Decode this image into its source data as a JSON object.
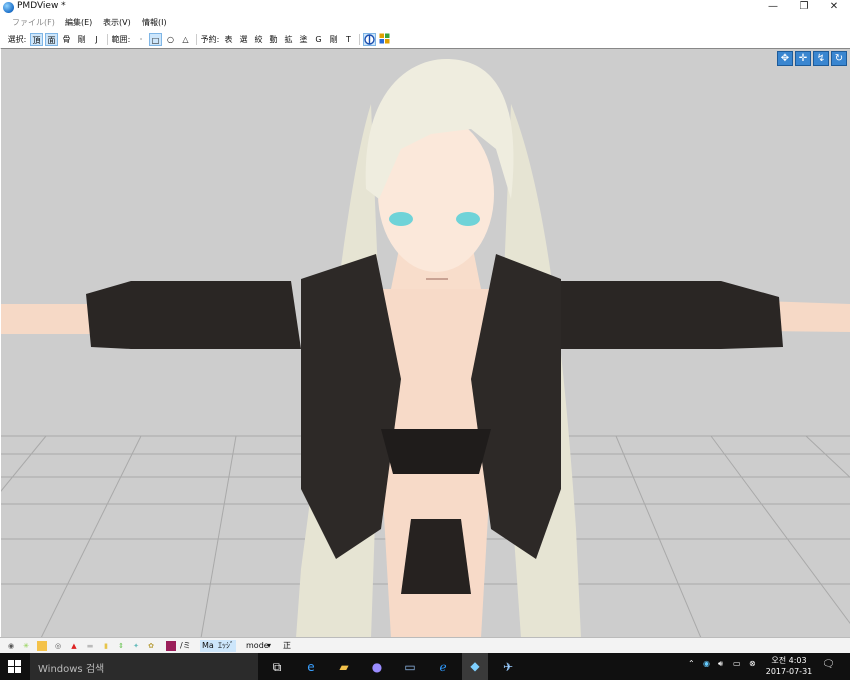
{
  "window": {
    "title": "PMDView *",
    "minimize": "—",
    "restore": "❐",
    "close": "✕"
  },
  "menu": [
    {
      "label": "ファイル(F)"
    },
    {
      "label": "編集(E)"
    },
    {
      "label": "表示(V)"
    },
    {
      "label": "情報(I)"
    }
  ],
  "toolbar": {
    "select_label": "選択:",
    "select_items": [
      "頂",
      "面",
      "骨",
      "剛",
      "J"
    ],
    "range_label": "範囲:",
    "range_items": [
      "·",
      "□",
      "○",
      "△"
    ],
    "display_label": "予約:",
    "display_items": [
      "表",
      "選",
      "絞",
      "動",
      "拡",
      "塗",
      "G",
      "剛",
      "T"
    ]
  },
  "viewport": {
    "controls": [
      "move-cross",
      "move-arrows",
      "zoom",
      "rotate"
    ],
    "colors": {
      "background": "#cdcdcd",
      "grid": "#a9a9a9"
    }
  },
  "bottom": {
    "mode_label": "mode",
    "mode_arrow": "▾",
    "text1": "/ミ",
    "text2": "Ma",
    "text3": "ｴｯｼﾞ",
    "text4": "正"
  },
  "taskbar": {
    "search_placeholder": "Windows 검색",
    "apps": [
      "task-view",
      "edge",
      "file-explorer",
      "app-sphere",
      "window-app",
      "ie",
      "pmdview",
      "satellite"
    ],
    "clock_time": "오전 4:03",
    "clock_date": "2017-07-31"
  }
}
